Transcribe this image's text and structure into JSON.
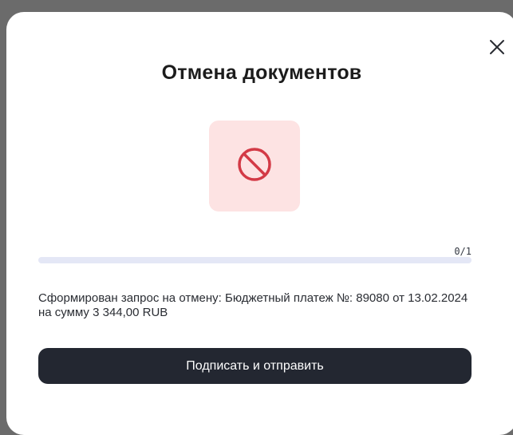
{
  "dialog": {
    "title": "Отмена документов",
    "close_icon": "close-icon",
    "status_icon": "prohibited-icon",
    "status_color": "#d33a46",
    "status_bg": "#fde3e3",
    "progress": {
      "label": "0/1",
      "completed": 0,
      "total": 1
    },
    "message": "Сформирован запрос на отмену: Бюджетный платеж №: 89080 от 13.02.2024 на сумму 3 344,00 RUB",
    "primary_button_label": "Подписать и отправить",
    "primary_button_color": "#232731"
  }
}
